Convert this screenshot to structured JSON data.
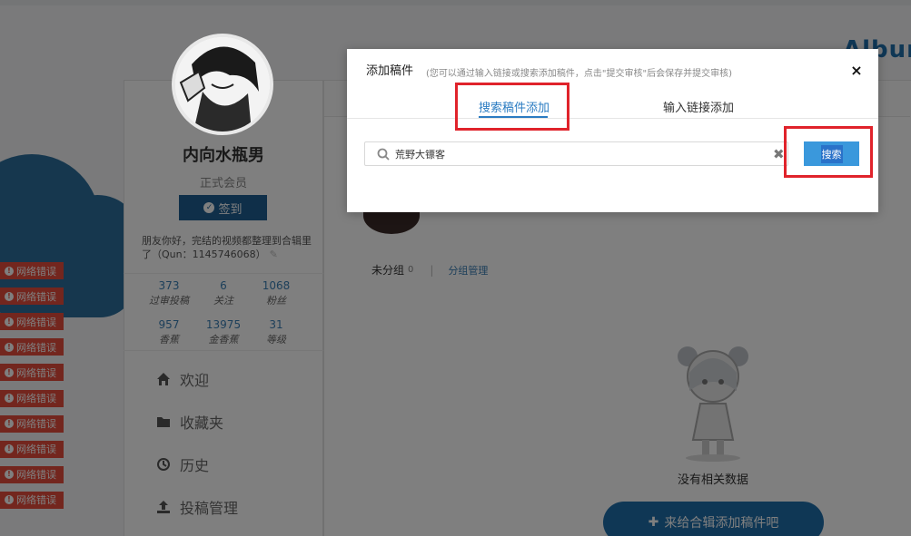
{
  "page": {
    "album_title": "Album",
    "username": "内向水瓶男",
    "member_level": "正式会员",
    "signin_label": "签到",
    "bio": "朋友你好，完结的视频都整理到合辑里了（Qun：1145746068）",
    "stats": [
      {
        "num": "373",
        "label": "过审投稿"
      },
      {
        "num": "6",
        "label": "关注"
      },
      {
        "num": "1068",
        "label": "粉丝"
      },
      {
        "num": "957",
        "label": "香蕉"
      },
      {
        "num": "13975",
        "label": "金香蕉"
      },
      {
        "num": "31",
        "label": "等级"
      }
    ],
    "nav": [
      {
        "label": "欢迎",
        "icon": "home-icon"
      },
      {
        "label": "收藏夹",
        "icon": "folder-icon"
      },
      {
        "label": "历史",
        "icon": "history-icon"
      },
      {
        "label": "投稿管理",
        "icon": "upload-icon"
      }
    ],
    "group_bar": {
      "ungrouped": "未分组",
      "count": "0",
      "manage": "分组管理"
    },
    "no_data": "没有相关数据",
    "add_album_label": "来给合辑添加稿件吧",
    "error_label": "网络错误",
    "error_count": 10
  },
  "dialog": {
    "title": "添加稿件",
    "subtitle": "(您可以通过输入链接或搜索添加稿件，点击\"提交审核\"后会保存并提交审核)",
    "close": "×",
    "tabs": [
      {
        "label": "搜索稿件添加",
        "active": true
      },
      {
        "label": "输入链接添加",
        "active": false
      }
    ],
    "search": {
      "value": "荒野大镖客",
      "placeholder": ""
    },
    "search_button": "搜索"
  },
  "colors": {
    "accent": "#2b7cc2",
    "button": "#3a98dc",
    "error": "#e74c3c",
    "highlight": "#e0232b",
    "brand_dark": "#1f5f93"
  }
}
